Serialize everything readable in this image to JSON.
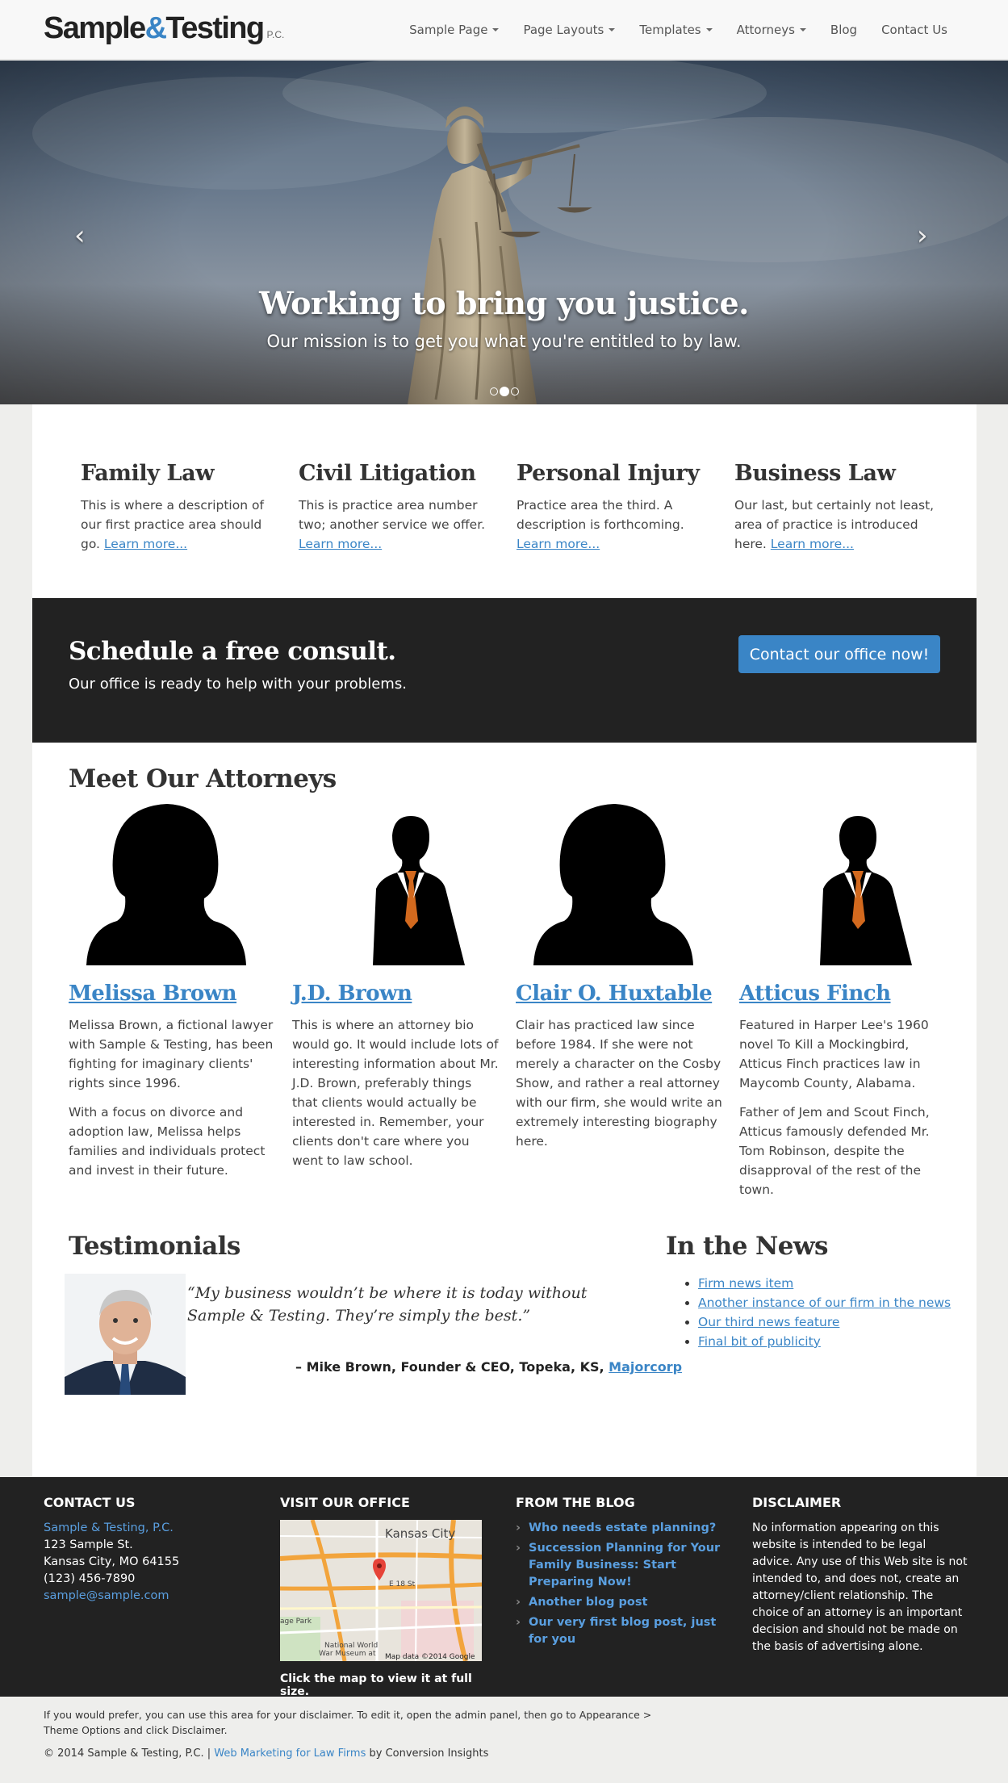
{
  "header": {
    "logo": {
      "part1": "Sample",
      "amp": "&",
      "part2": "Testing",
      "suffix": "P.C."
    },
    "nav": [
      {
        "label": "Sample Page",
        "dropdown": true
      },
      {
        "label": "Page Layouts",
        "dropdown": true
      },
      {
        "label": "Templates",
        "dropdown": true
      },
      {
        "label": "Attorneys",
        "dropdown": true
      },
      {
        "label": "Blog",
        "dropdown": false
      },
      {
        "label": "Contact Us",
        "dropdown": false
      }
    ]
  },
  "hero": {
    "title": "Working to bring you justice.",
    "subtitle": "Our mission is to get you what you're entitled to by law.",
    "prev_icon": "chevron-left-icon",
    "next_icon": "chevron-right-icon",
    "slides": 3,
    "active_slide": 2
  },
  "practice_areas": [
    {
      "title": "Family Law",
      "text": "This is where a description of our first practice area should go.",
      "link": "Learn more..."
    },
    {
      "title": "Civil Litigation",
      "text": "This is practice area number two; another service we offer.",
      "link": "Learn more..."
    },
    {
      "title": "Personal Injury",
      "text": "Practice area the third. A description is forthcoming.",
      "link": "Learn more..."
    },
    {
      "title": "Business Law",
      "text": "Our last, but certainly not least, area of practice is introduced here.",
      "link": "Learn more..."
    }
  ],
  "consult": {
    "title": "Schedule a free consult.",
    "subtitle": "Our office is ready to help with your problems.",
    "button": "Contact our office now!",
    "accent": "#3a85c6"
  },
  "attorneys": {
    "title": "Meet Our Attorneys",
    "items": [
      {
        "name": "Melissa Brown",
        "silhouette": "female",
        "paragraphs": [
          "Melissa Brown, a fictional lawyer with Sample & Testing, has been fighting for imaginary clients' rights since 1996.",
          "With a focus on divorce and adoption law, Melissa helps families and individuals protect and invest in their future."
        ]
      },
      {
        "name": "J.D. Brown",
        "silhouette": "male",
        "paragraphs": [
          "This is where an attorney bio would go. It would include lots of interesting information about Mr. J.D. Brown, preferably things that clients would actually be interested in. Remember, your clients don't care where you went to law school."
        ]
      },
      {
        "name": "Clair O. Huxtable",
        "silhouette": "female",
        "paragraphs": [
          "Clair has practiced law since before 1984. If she were not merely a character on the Cosby Show, and rather a real attorney with our firm, she would write an extremely interesting biography here."
        ]
      },
      {
        "name": "Atticus Finch",
        "silhouette": "male",
        "paragraphs": [
          "Featured in Harper Lee's 1960 novel To Kill a Mockingbird, Atticus Finch practices law in Maycomb County, Alabama.",
          "Father of Jem and Scout Finch, Atticus famously defended Mr. Tom Robinson, despite the disapproval of the rest of the town."
        ]
      }
    ]
  },
  "testimonials": {
    "title": "Testimonials",
    "quote": "“My business wouldn’t be where it is today without Sample & Testing. They’re simply the best.”",
    "by": "– Mike Brown, Founder & CEO, Topeka, KS,",
    "company": "Majorcorp"
  },
  "news": {
    "title": "In the News",
    "items": [
      "Firm news item",
      "Another instance of our firm in the news",
      "Our third news feature",
      "Final bit of publicity"
    ]
  },
  "footer": {
    "contact": {
      "title": "CONTACT US",
      "firm": "Sample & Testing, P.C.",
      "street": "123 Sample St.",
      "city": "Kansas City, MO 64155",
      "phone": "(123) 456-7890",
      "email": "sample@sample.com"
    },
    "office": {
      "title": "VISIT OUR OFFICE",
      "map_city": "Kansas City",
      "map_labels": [
        "E 18 St",
        "age Park",
        "National World",
        "War Museum at",
        "Map data ©2014 Google"
      ],
      "caption": "Click the map to view it at full size."
    },
    "blog": {
      "title": "FROM THE BLOG",
      "items": [
        "Who needs estate planning?",
        "Succession Planning for Your Family Business: Start Preparing Now!",
        "Another blog post",
        "Our very first blog post, just for you"
      ]
    },
    "disclaimer": {
      "title": "DISCLAIMER",
      "text": "No information appearing on this website is intended to be legal advice. Any use of this Web site is not intended to, and does not, create an attorney/client relationship. The choice of an attorney is an important decision and should not be made on the basis of advertising alone."
    }
  },
  "subfooter": {
    "note": "If you would prefer, you can use this area for your disclaimer. To edit it, open the admin panel, then go to Appearance > Theme Options and click Disclaimer.",
    "copyright": "© 2014 Sample & Testing, P.C. |",
    "link": "Web Marketing for Law Firms",
    "by": "by Conversion Insights"
  }
}
